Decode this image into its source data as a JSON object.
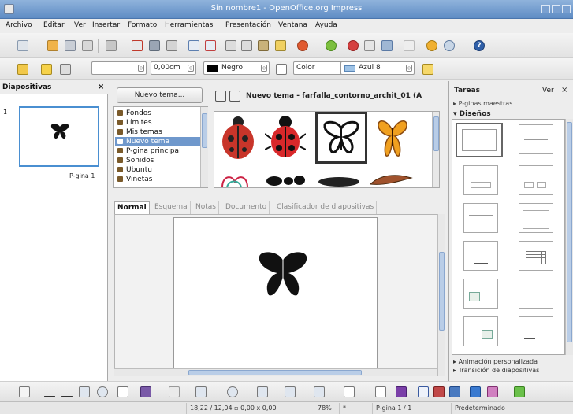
{
  "window": {
    "title": "Sin nombre1 - OpenOffice.org Impress"
  },
  "menu": [
    "Archivo",
    "Editar",
    "Ver",
    "Insertar",
    "Formato",
    "Herramientas",
    "Presentación",
    "Ventana",
    "Ayuda"
  ],
  "toolbar2": {
    "line_width": "0,00cm",
    "line_color": "Negro",
    "area_style": "Color",
    "area_color": "Azul 8"
  },
  "slides_pane": {
    "title": "Diapositivas",
    "close": "×",
    "slide_number": "1",
    "slide_name": "P-gina 1"
  },
  "gallery": {
    "new_theme_button": "Nuevo tema...",
    "themes": [
      "Fondos",
      "Límites",
      "Mis temas",
      "Nuevo tema",
      "P-gina principal",
      "Sonidos",
      "Ubuntu",
      "Viñetas"
    ],
    "selected_theme": "Nuevo tema",
    "header_title": "Nuevo tema - farfalla_contorno_archit_01 (A"
  },
  "view_tabs": [
    "Normal",
    "Esquema",
    "Notas",
    "Documento",
    "Clasificador de diapositivas"
  ],
  "tasks": {
    "title": "Tareas",
    "view": "Ver",
    "close": "×",
    "master_pages": "P-ginas maestras",
    "layouts": "Diseños",
    "custom_animation": "Animación personalizada",
    "slide_transition": "Transición de diapositivas"
  },
  "status": {
    "position": "18,22 / 12,04",
    "size": "0,00 x 0,00",
    "zoom": "78%",
    "modified": "*",
    "page": "P-gina 1 / 1",
    "master": "Predeterminado"
  },
  "colors": {
    "title_bar": "#6f98cc",
    "selection": "#6f98cc",
    "slide_border": "#4a8fd1"
  }
}
